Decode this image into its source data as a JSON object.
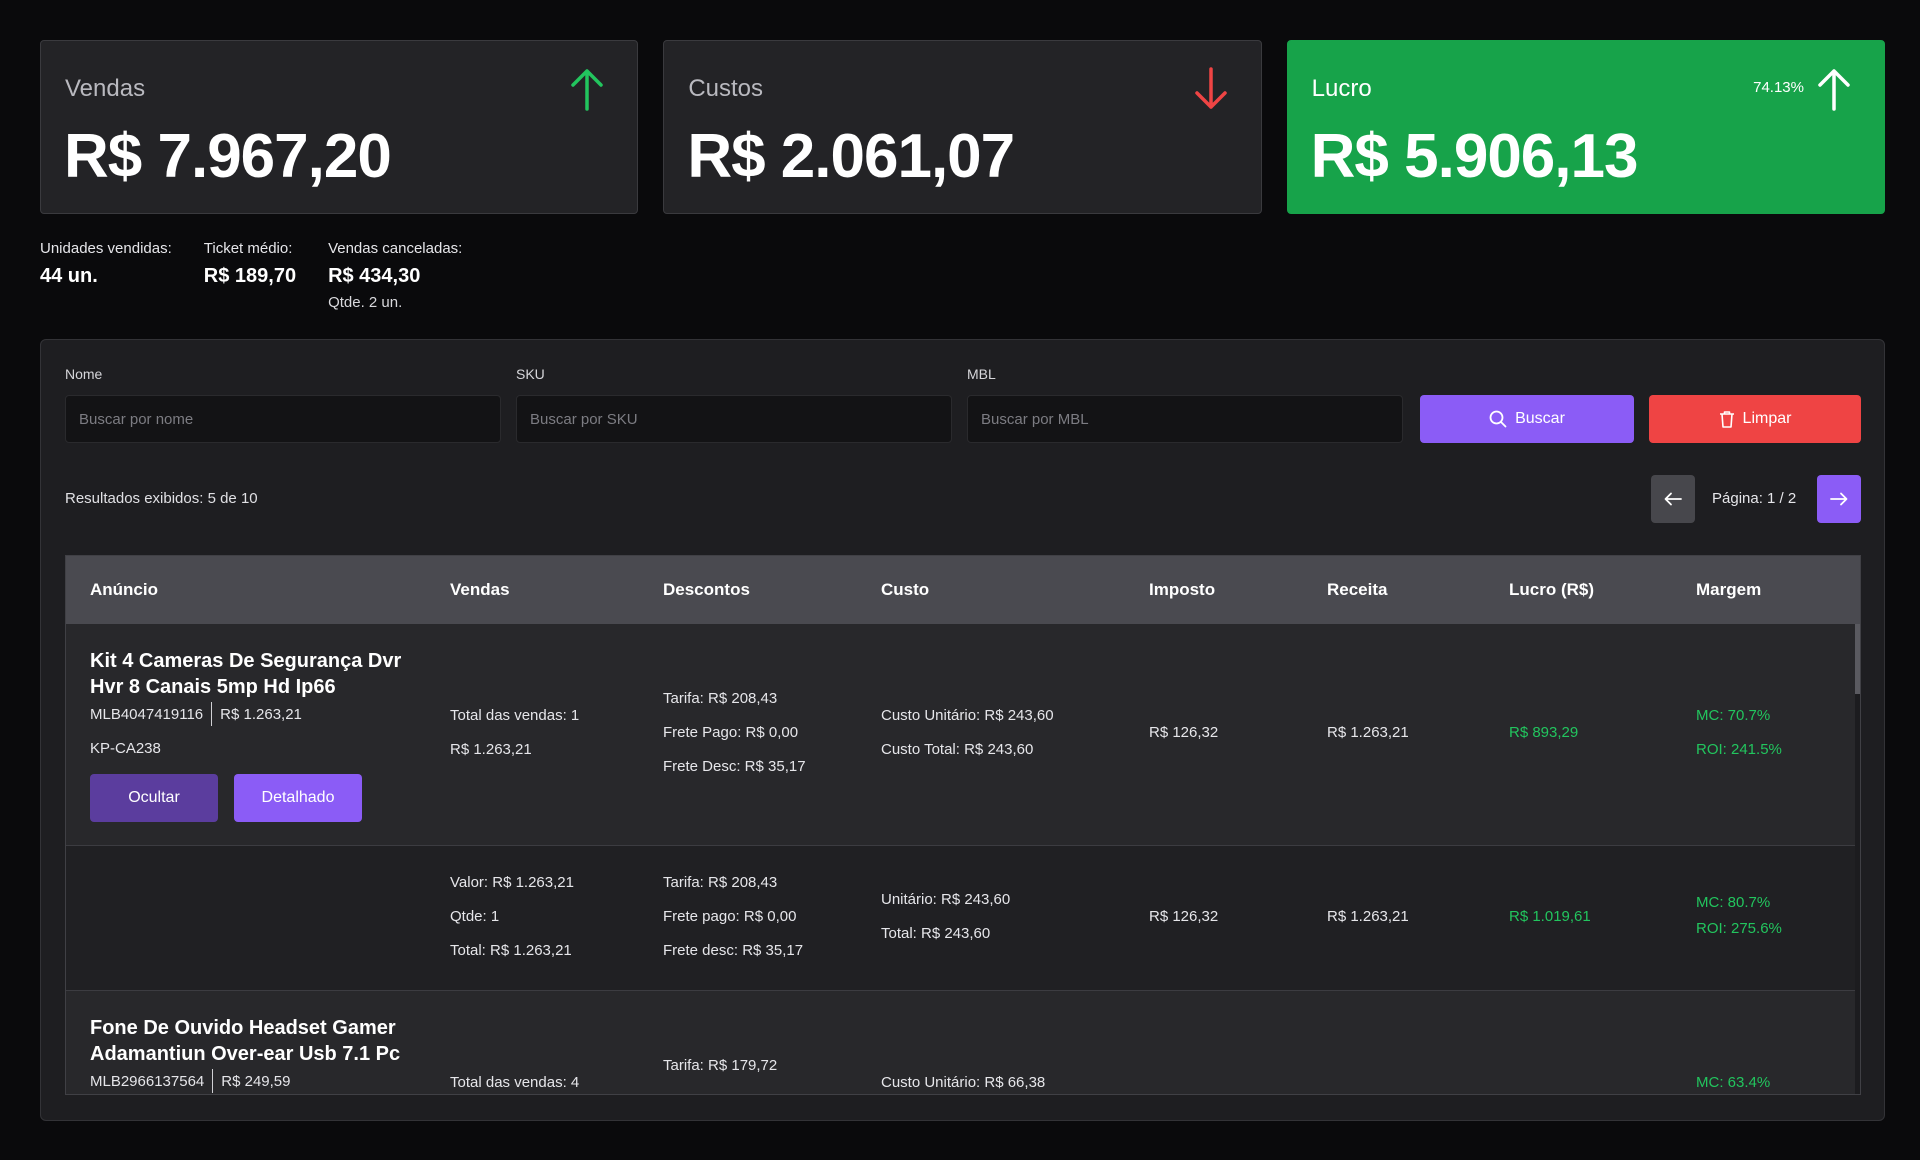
{
  "cards": {
    "vendas": {
      "label": "Vendas",
      "value": "R$ 7.967,20",
      "trend": "up",
      "arrow_color": "#22c55e"
    },
    "custos": {
      "label": "Custos",
      "value": "R$ 2.061,07",
      "trend": "down",
      "arrow_color": "#ef4444"
    },
    "lucro": {
      "label": "Lucro",
      "value": "R$ 5.906,13",
      "percent": "74.13%",
      "trend": "up",
      "bg_color": "#17a34a"
    }
  },
  "stats": {
    "unidades": {
      "label": "Unidades vendidas:",
      "value": "44 un."
    },
    "ticket": {
      "label": "Ticket médio:",
      "value": "R$ 189,70"
    },
    "canceladas": {
      "label": "Vendas canceladas:",
      "value": "R$ 434,30",
      "sub": "Qtde. 2 un."
    }
  },
  "filters": {
    "nome": {
      "label": "Nome",
      "placeholder": "Buscar por nome",
      "value": ""
    },
    "sku": {
      "label": "SKU",
      "placeholder": "Buscar por SKU",
      "value": ""
    },
    "mbl": {
      "label": "MBL",
      "placeholder": "Buscar por MBL",
      "value": ""
    },
    "buscar_label": "Buscar",
    "limpar_label": "Limpar"
  },
  "results_text": "Resultados exibidos: 5 de 10",
  "pagination": {
    "label": "Página: 1 / 2"
  },
  "table": {
    "headers": [
      "Anúncio",
      "Vendas",
      "Descontos",
      "Custo",
      "Imposto",
      "Receita",
      "Lucro (R$)",
      "Margem"
    ],
    "rows": [
      {
        "title": "Kit 4 Cameras De Segurança Dvr Hvr 8 Canais 5mp Hd Ip66",
        "mlb": "MLB4047419116",
        "price": "R$ 1.263,21",
        "sku": "KP-CA238",
        "btn_ocultar": "Ocultar",
        "btn_detalhado": "Detalhado",
        "vendas": [
          "Total das vendas: 1",
          "R$ 1.263,21"
        ],
        "descontos": [
          "Tarifa: R$ 208,43",
          "Frete Pago: R$ 0,00",
          "Frete Desc: R$ 35,17"
        ],
        "custo": [
          "Custo Unitário: R$ 243,60",
          "Custo Total: R$ 243,60"
        ],
        "imposto": "R$ 126,32",
        "receita": "R$ 1.263,21",
        "lucro": "R$ 893,29",
        "margem": [
          "MC: 70.7%",
          "ROI: 241.5%"
        ]
      },
      {
        "vendas": [
          "Valor: R$ 1.263,21",
          "Qtde: 1",
          "Total: R$ 1.263,21"
        ],
        "descontos": [
          "Tarifa: R$ 208,43",
          "Frete pago: R$ 0,00",
          "Frete desc: R$ 35,17"
        ],
        "custo": [
          "Unitário: R$ 243,60",
          "Total: R$ 243,60"
        ],
        "imposto": "R$ 126,32",
        "receita": "R$ 1.263,21",
        "lucro": "R$ 1.019,61",
        "margem": [
          "MC: 80.7%",
          "ROI: 275.6%"
        ]
      },
      {
        "title": "Fone De Ouvido Headset Gamer Adamantiun Over-ear Usb 7.1 Pc",
        "mlb": "MLB2966137564",
        "price": "R$ 249,59",
        "vendas": [
          "Total das vendas: 4"
        ],
        "descontos": [
          "Tarifa: R$ 179,72"
        ],
        "custo": [
          "Custo Unitário: R$ 66,38"
        ],
        "margem": [
          "MC: 63.4%"
        ]
      }
    ]
  },
  "colors": {
    "accent": "#8b5cf6",
    "danger": "#ef4444",
    "success": "#22c55e",
    "profit_card": "#17a34a"
  }
}
